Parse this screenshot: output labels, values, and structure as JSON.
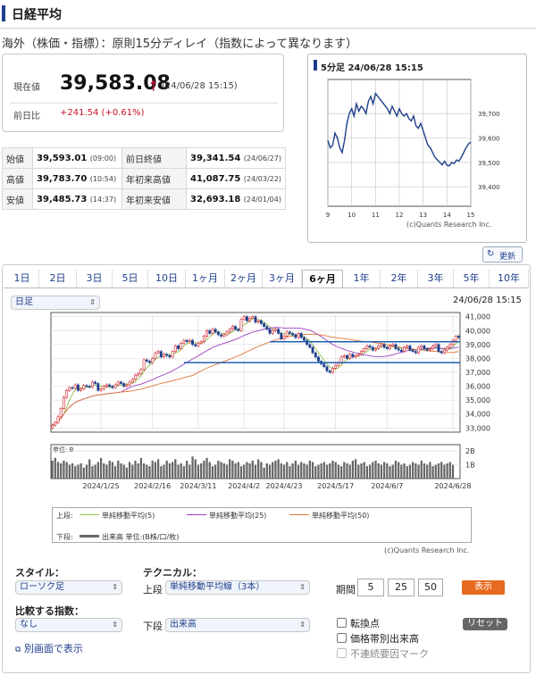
{
  "header": {
    "title": "日経平均"
  },
  "subtitle": "海外（株価・指標）：原則15分ディレイ（指数によって異なります）",
  "price": {
    "current_label": "現在値",
    "current_value": "39,583.08",
    "arrow": "↑",
    "datetime": "(24/06/28 15:15)",
    "change_label": "前日比",
    "change_value": "+241.54 (+0.61%)"
  },
  "stats": [
    {
      "k1": "始値",
      "v1": "39,593.01",
      "n1": "(09:00)",
      "k2": "前日終値",
      "v2": "39,341.54",
      "n2": "(24/06/27)"
    },
    {
      "k1": "高値",
      "v1": "39,783.70",
      "n1": "(10:54)",
      "k2": "年初来高値",
      "v2": "41,087.75",
      "n2": "(24/03/22)"
    },
    {
      "k1": "安値",
      "v1": "39,485.73",
      "n1": "(14:37)",
      "k2": "年初来安値",
      "v2": "32,693.18",
      "n2": "(24/01/04)"
    }
  ],
  "mini": {
    "title": "5分足 24/06/28 15:15",
    "credit": "(c)Quants Research Inc."
  },
  "refresh_label": "更新",
  "tabs": [
    "1日",
    "2日",
    "3日",
    "5日",
    "10日",
    "1ヶ月",
    "2ヶ月",
    "3ヶ月",
    "6ヶ月",
    "1年",
    "2年",
    "3年",
    "5年",
    "10年"
  ],
  "active_tab": "6ヶ月",
  "period_select": "日足",
  "main_datetime": "24/06/28 15:15",
  "volume_unit": "単位: B",
  "legend": {
    "upper": "上段:",
    "lower": "下段:",
    "ma5": "単純移動平均(5)",
    "ma25": "単純移動平均(25)",
    "ma50": "単純移動平均(50)",
    "volume": "出来高 単位:(B株/口/枚)"
  },
  "main_credit": "(c)Quants Research Inc.",
  "controls": {
    "style_label": "スタイル：",
    "style_value": "ローソク足",
    "technical_label": "テクニカル：",
    "upper_label": "上段",
    "upper_value": "単純移動平均線（3本）",
    "period_label": "期間",
    "p1": "5",
    "p2": "25",
    "p3": "50",
    "show_button": "表示",
    "compare_label": "比較する指数：",
    "compare_value": "なし",
    "lower_label": "下段",
    "lower_value": "出来高",
    "reset_button": "リセット",
    "check1": "転換点",
    "check2": "価格帯別出来高",
    "check3": "不連続要因マーク",
    "popout_link": "別画面で表示"
  },
  "colors": {
    "up": "#d21f2b",
    "down": "#1f3f8c",
    "ma5": "#8ec44a",
    "ma25": "#9b3fc0",
    "ma50": "#e0773a"
  },
  "chart_data": [
    {
      "type": "line",
      "x_ticks": [
        "9",
        "10",
        "11",
        "12",
        "13",
        "14",
        "15"
      ],
      "y_ticks": [
        39400,
        39500,
        39600,
        39700
      ],
      "ylim": [
        39320,
        39840
      ],
      "x": [
        9.0,
        9.1,
        9.2,
        9.3,
        9.4,
        9.5,
        9.6,
        9.7,
        9.8,
        9.9,
        10.0,
        10.1,
        10.2,
        10.3,
        10.4,
        10.5,
        10.6,
        10.7,
        10.8,
        10.9,
        11.0,
        11.5,
        11.6,
        11.7,
        11.8,
        11.9,
        12.0,
        12.1,
        12.2,
        12.3,
        12.4,
        12.5,
        12.6,
        12.7,
        12.8,
        12.9,
        13.0,
        13.1,
        13.2,
        13.3,
        13.4,
        13.5,
        13.6,
        13.7,
        13.8,
        13.9,
        14.0,
        14.1,
        14.2,
        14.3,
        14.4,
        14.5,
        14.6,
        14.7,
        14.8,
        14.9,
        15.0
      ],
      "y": [
        39590,
        39560,
        39570,
        39620,
        39600,
        39560,
        39540,
        39590,
        39660,
        39700,
        39720,
        39690,
        39740,
        39710,
        39730,
        39720,
        39700,
        39750,
        39770,
        39740,
        39783,
        39720,
        39700,
        39730,
        39710,
        39690,
        39720,
        39700,
        39690,
        39700,
        39680,
        39670,
        39690,
        39650,
        39640,
        39660,
        39630,
        39600,
        39570,
        39560,
        39540,
        39520,
        39510,
        39500,
        39490,
        39505,
        39488,
        39486,
        39500,
        39495,
        39510,
        39505,
        39520,
        39540,
        39560,
        39575,
        39583
      ]
    },
    {
      "type": "candlestick",
      "categories_ticks": [
        "2024/1/25",
        "2024/2/16",
        "2024/3/11",
        "2024/4/2",
        "2024/4/23",
        "2024/5/17",
        "2024/6/7",
        "2024/6/28"
      ],
      "y_ticks": [
        33000,
        34000,
        35000,
        36000,
        37000,
        38000,
        39000,
        40000,
        41000
      ],
      "ylim": [
        32700,
        41300
      ],
      "close": [
        33200,
        33400,
        33800,
        34400,
        35200,
        35700,
        35900,
        35850,
        36100,
        35700,
        35800,
        36050,
        36000,
        35950,
        36300,
        36200,
        35700,
        35800,
        36000,
        36100,
        36000,
        35900,
        36100,
        36300,
        36200,
        36000,
        36100,
        36300,
        36500,
        36800,
        36900,
        37200,
        37900,
        37800,
        37700,
        38000,
        38400,
        38500,
        38100,
        38300,
        38200,
        38100,
        38500,
        38900,
        38700,
        39100,
        39300,
        39200,
        39300,
        39000,
        38900,
        39100,
        39200,
        39600,
        40000,
        39800,
        40100,
        39900,
        39700,
        39600,
        39700,
        39900,
        40100,
        40300,
        40100,
        40000,
        40800,
        41000,
        40700,
        40900,
        41000,
        40600,
        40700,
        40500,
        40300,
        40100,
        39800,
        40000,
        40100,
        39800,
        39400,
        39600,
        39900,
        39800,
        39700,
        39500,
        39800,
        39500,
        39300,
        39000,
        38800,
        38400,
        38100,
        37800,
        37600,
        37400,
        37100,
        37000,
        37300,
        37500,
        37700,
        38100,
        38200,
        38000,
        38300,
        38100,
        38200,
        38300,
        38500,
        38700,
        38900,
        38800,
        38600,
        38700,
        38900,
        39000,
        38800,
        38700,
        38900,
        39000,
        38700,
        38600,
        38500,
        38800,
        38900,
        38600,
        38500,
        38400,
        38800,
        38900,
        38700,
        38600,
        38700,
        38900,
        39000,
        38500,
        38400,
        38600,
        38800,
        39000,
        39300,
        39600,
        39500
      ],
      "volume_ylim": [
        0,
        2.2
      ],
      "volume_ticks": [
        1,
        2
      ],
      "volume": [
        1.3,
        1.5,
        1.2,
        1.1,
        1.3,
        1.2,
        1.0,
        1.1,
        0.9,
        1.0,
        1.1,
        0.8,
        1.0,
        1.4,
        0.9,
        1.0,
        1.2,
        1.5,
        1.1,
        1.0,
        1.3,
        1.2,
        0.9,
        1.3,
        1.1,
        1.0,
        0.8,
        1.2,
        1.0,
        1.3,
        1.1,
        1.5,
        1.1,
        1.0,
        0.9,
        1.3,
        1.2,
        1.4,
        0.9,
        1.0,
        1.3,
        1.1,
        1.2,
        1.4,
        1.0,
        1.1,
        0.9,
        1.3,
        1.0,
        1.6,
        1.4,
        1.0,
        1.1,
        1.3,
        1.5,
        1.2,
        0.9,
        1.0,
        1.3,
        1.2,
        1.1,
        1.0,
        1.4,
        1.3,
        1.1,
        1.2,
        0.9,
        1.0,
        1.2,
        1.1,
        1.3,
        1.0,
        1.4,
        1.2,
        0.8,
        1.1,
        1.0,
        1.2,
        1.3,
        1.4,
        1.1,
        1.0,
        1.2,
        0.9,
        1.1,
        1.3,
        1.0,
        1.2,
        1.1,
        1.0,
        1.3,
        1.2,
        0.9,
        1.0,
        1.1,
        1.2,
        1.0,
        1.1,
        1.3,
        1.2,
        1.0,
        0.9,
        1.2,
        1.1,
        1.0,
        1.3,
        1.4,
        1.0,
        1.1,
        1.2,
        0.9,
        1.0,
        1.2,
        1.3,
        1.1,
        1.0,
        1.2,
        1.1,
        0.9,
        1.0,
        1.3,
        1.2,
        1.0,
        1.1,
        0.9,
        1.0,
        1.2,
        1.1,
        1.0,
        1.3,
        1.1,
        1.0,
        1.2,
        0.9,
        1.0,
        1.1,
        1.2,
        1.0,
        1.1,
        1.2,
        1.0
      ],
      "hlines": [
        39200,
        37700
      ]
    }
  ]
}
